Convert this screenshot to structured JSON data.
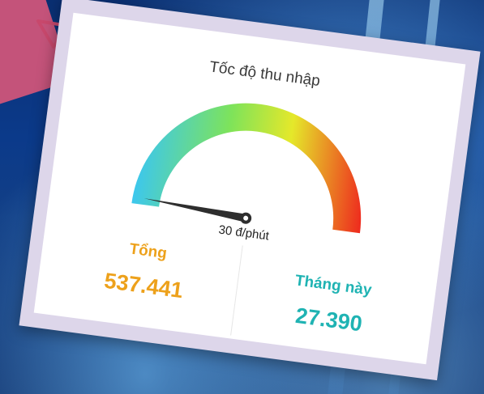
{
  "gauge": {
    "title": "Tốc độ thu nhập",
    "value_label": "30 đ/phút",
    "needle_fraction": 0.02
  },
  "stats": {
    "total_label": "Tổng",
    "total_value": "537.441",
    "month_label": "Tháng này",
    "month_value": "27.390"
  },
  "colors": {
    "orange": "#eda11b",
    "teal": "#1fb3b3",
    "frame": "#ddd6ea",
    "accent_pink": "#c4537a",
    "gauge_start": "#3cc7ee",
    "gauge_mid": "#7ee35a",
    "gauge_yellow": "#e5e82a",
    "gauge_end": "#ee2a1e"
  }
}
